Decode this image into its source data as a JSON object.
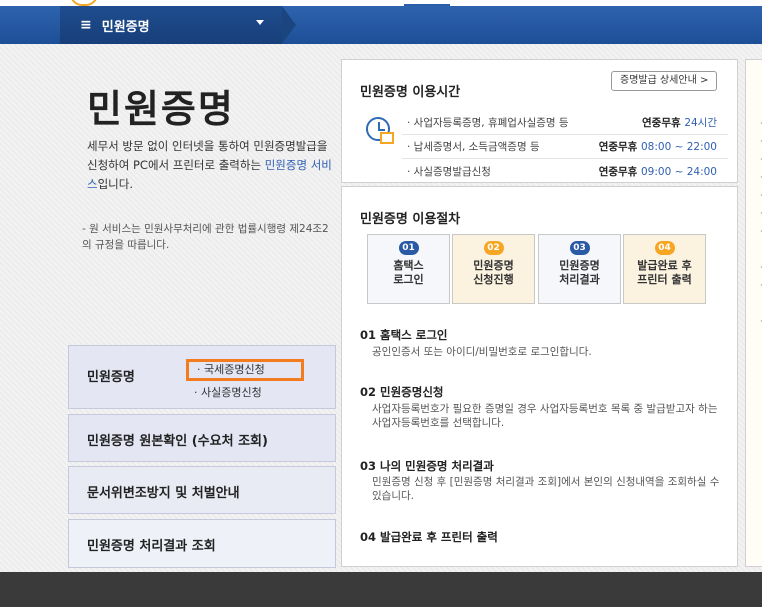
{
  "nav": {
    "menu_icon": "hamburger-icon",
    "menu_label": "민원증명"
  },
  "left": {
    "title": "민원증명",
    "intro_part1": "세무서 방문 없이 인터넷을 통하여 민원증명발급을 신청하여 PC에서 프린터로 출력하는 ",
    "intro_link": "민원증명 서비스",
    "intro_part2": "입니다.",
    "notice": "- 원 서비스는 민원사무처리에 관한 법률시행령 제24조2의 규정을 따릅니다.",
    "menu_boxes": [
      {
        "label": "민원증명",
        "subs": [
          "· 국세증명신청",
          "· 사실증명신청"
        ]
      },
      {
        "label": "민원증명 원본확인 (수요처 조회)"
      },
      {
        "label": "문서위변조방지 및 처벌안내"
      },
      {
        "label": "민원증명 처리결과 조회"
      }
    ]
  },
  "hours": {
    "title": "민원증명 이용시간",
    "detail_button": "증명발급 상세안내 >",
    "icon": "clock-calendar-icon",
    "rows": [
      {
        "label": "· 사업자등록증명, 휴폐업사실증명 등",
        "prefix": "연중무휴 ",
        "value": "24시간"
      },
      {
        "label": "· 납세증명서, 소득금액증명 등",
        "prefix": "연중무휴 ",
        "value": "08:00 ~ 22:00"
      },
      {
        "label": "· 사실증명발급신청",
        "prefix": "연중무휴 ",
        "value": "09:00 ~ 24:00"
      }
    ]
  },
  "procedure": {
    "title": "민원증명 이용절차",
    "steps": [
      {
        "num": "01",
        "label": "홈택스\n로그인"
      },
      {
        "num": "02",
        "label": "민원증명\n신청진행"
      },
      {
        "num": "03",
        "label": "민원증명\n처리결과"
      },
      {
        "num": "04",
        "label": "발급완료 후\n프린터 출력"
      }
    ],
    "sections": [
      {
        "title": "01 홈택스 로그인",
        "text": "공인인증서 또는 아이디/비밀번호로 로그인합니다."
      },
      {
        "title": "02 민원증명신청",
        "text": "사업자등록번호가 필요한 증명일 경우 사업자등록번호 목록 중 발급받고자 하는 사업자등록번호를 선택합니다."
      },
      {
        "title": "03 나의 민원증명 처리결과",
        "text": "민원증명 신청 후 [민원증명 처리결과 조회]에서 본인의 신청내역을 조회하실 수 있습니다."
      },
      {
        "title": "04 발급완료 후 프린터 출력",
        "text": ""
      }
    ]
  },
  "colors": {
    "nav": "#1d4f97",
    "accent_blue": "#2a59a5",
    "accent_orange": "#f6a623",
    "highlight_border": "#f47c20"
  }
}
